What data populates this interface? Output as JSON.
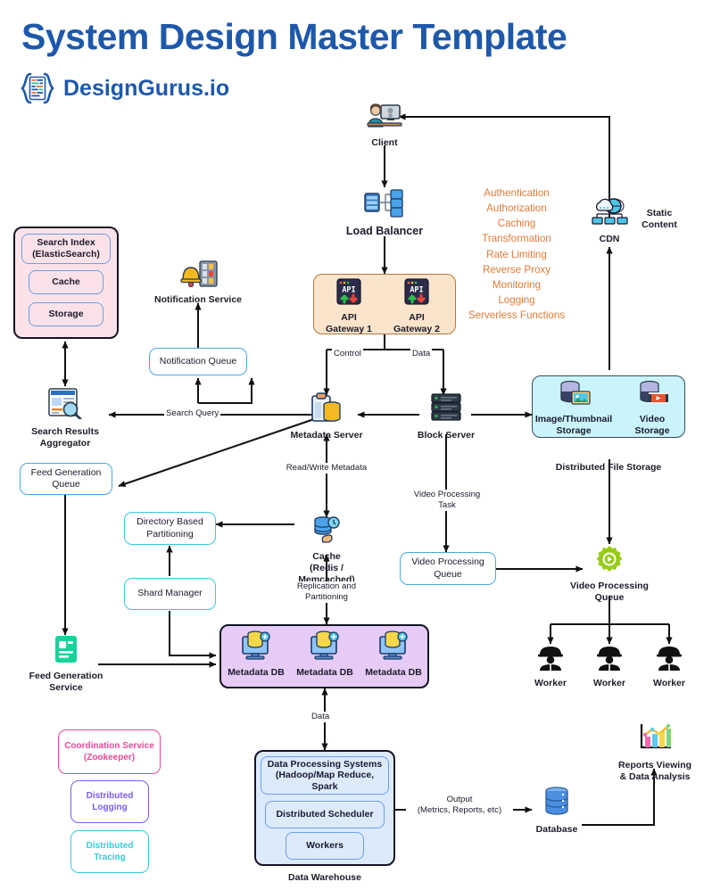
{
  "header": {
    "title": "System Design Master Template",
    "brand": "DesignGurus.io",
    "logo_icon": "code-braces-logo-icon",
    "title_color": "#1e58ab"
  },
  "nodes": {
    "client": {
      "label": "Client",
      "icon": "client-user-computer-icon"
    },
    "load_balancer": {
      "label": "Load Balancer",
      "icon": "load-balancer-icon"
    },
    "api_gateway_1": {
      "label": "API\nGateway 1",
      "icon": "api-gateway-icon"
    },
    "api_gateway_2": {
      "label": "API\nGateway 2",
      "icon": "api-gateway-icon"
    },
    "cdn": {
      "label": "CDN",
      "icon": "cdn-cloud-globe-icon"
    },
    "static_content": {
      "label": "Static\nContent"
    },
    "notification_service": {
      "label": "Notification Service",
      "icon": "notification-bell-server-icon"
    },
    "notification_queue": {
      "label": "Notification Queue"
    },
    "search_results_aggregator": {
      "label": "Search Results\nAggregator",
      "icon": "search-results-document-icon"
    },
    "metadata_server": {
      "label": "Metadata Server",
      "icon": "metadata-clipboard-db-icon"
    },
    "block_server": {
      "label": "Block Server",
      "icon": "block-server-rack-icon"
    },
    "feed_generation_queue": {
      "label": "Feed Generation\nQueue"
    },
    "directory_based_partitioning": {
      "label": "Directory Based\nPartitioning"
    },
    "shard_manager": {
      "label": "Shard Manager"
    },
    "feed_generation_service": {
      "label": "Feed Generation\nService",
      "icon": "feed-service-icon"
    },
    "cache": {
      "label": "Cache\n(Redis / Memcached)",
      "icon": "cache-db-hand-icon"
    },
    "video_processing_queue_box": {
      "label": "Video Processing\nQueue"
    },
    "video_processing_queue_gear": {
      "label": "Video Processing\nQueue",
      "icon": "gear-play-icon"
    },
    "database": {
      "label": "Database",
      "icon": "database-cylinder-icon"
    },
    "reports_viewing": {
      "label": "Reports Viewing\n& Data Analysis",
      "icon": "bar-chart-report-icon"
    }
  },
  "search_index_panel": {
    "items": [
      {
        "label": "Search Index\n(ElasticSearch)"
      },
      {
        "label": "Cache"
      },
      {
        "label": "Storage"
      }
    ],
    "fill": "#fbe2e8",
    "border": "#141425"
  },
  "api_gateway_panel": {
    "fill": "#fbe4cc",
    "border": "#b5773a"
  },
  "distributed_file_storage": {
    "caption": "Distributed File Storage",
    "fill": "#c9f4fb",
    "items": [
      {
        "label": "Image/Thumbnail\nStorage",
        "icon": "image-thumbnail-storage-icon"
      },
      {
        "label": "Video\nStorage",
        "icon": "video-storage-icon"
      }
    ]
  },
  "metadata_db_panel": {
    "fill": "#e7cbf7",
    "border": "#141425",
    "items": [
      {
        "label": "Metadata DB",
        "icon": "metadata-db-monitor-icon"
      },
      {
        "label": "Metadata DB",
        "icon": "metadata-db-monitor-icon"
      },
      {
        "label": "Metadata DB",
        "icon": "metadata-db-monitor-icon"
      }
    ]
  },
  "workers": [
    {
      "label": "Worker",
      "icon": "worker-helmet-icon"
    },
    {
      "label": "Worker",
      "icon": "worker-helmet-icon"
    },
    {
      "label": "Worker",
      "icon": "worker-helmet-icon"
    }
  ],
  "api_gateway_features": {
    "color": "#e07b39",
    "items": [
      "Authentication",
      "Authorization",
      "Caching",
      "Transformation",
      "Rate Limiting",
      "Reverse Proxy",
      "Monitoring",
      "Logging",
      "Serverless Functions"
    ]
  },
  "data_warehouse": {
    "caption": "Data Warehouse",
    "fill": "#dceafc",
    "border": "#141425",
    "items": [
      {
        "label": "Data Processing Systems\n(Hadoop/Map Reduce, Spark"
      },
      {
        "label": "Distributed Scheduler"
      },
      {
        "label": "Workers"
      }
    ]
  },
  "corner_boxes": [
    {
      "label": "Coordination Service\n(Zookeeper)",
      "color": "#ec4899"
    },
    {
      "label": "Distributed\nLogging",
      "color": "#7c5cf0"
    },
    {
      "label": "Distributed\nTracing",
      "color": "#3cc8d8"
    }
  ],
  "edge_labels": {
    "control": "Control",
    "data_top": "Data",
    "search_query": "Search Query",
    "read_write_metadata": "Read/Write Metadata",
    "video_processing_task": "Video Processing\nTask",
    "replication_partitioning": "Replication and\nPartitioning",
    "data_bottom": "Data",
    "output": "Output\n(Metrics, Reports, etc)"
  }
}
